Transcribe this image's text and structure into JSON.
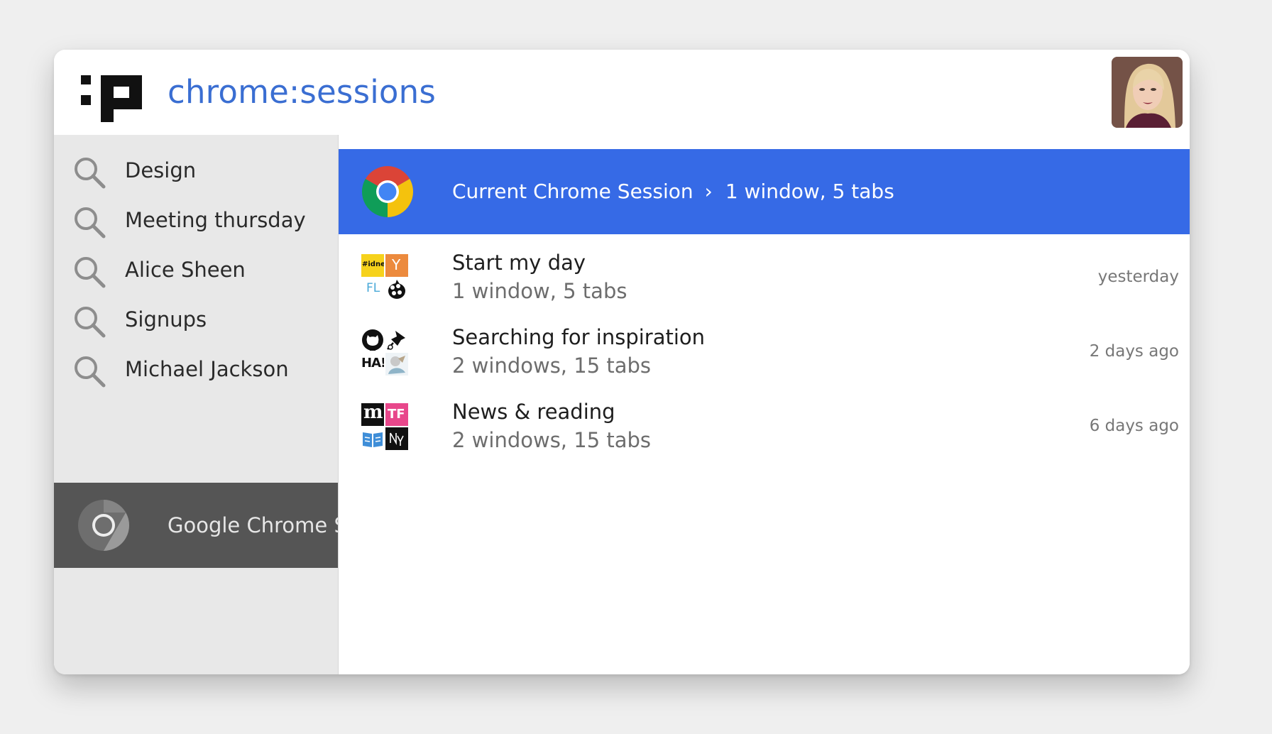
{
  "header": {
    "title": "chrome:sessions",
    "logo_icon": "pinbox-logo-icon",
    "avatar_icon": "user-avatar"
  },
  "sidebar": {
    "items": [
      {
        "label": "Design",
        "icon": "search-icon"
      },
      {
        "label": "Meeting thursday",
        "icon": "search-icon"
      },
      {
        "label": "Alice Sheen",
        "icon": "search-icon"
      },
      {
        "label": "Signups",
        "icon": "search-icon"
      },
      {
        "label": "Michael Jackson",
        "icon": "search-icon"
      }
    ],
    "active": {
      "label": "Google Chrome Sessions",
      "icon": "chrome-icon"
    }
  },
  "current_session": {
    "title": "Current Chrome Session",
    "separator": "›",
    "detail": "1 window, 5 tabs",
    "icon": "chrome-icon"
  },
  "sessions": [
    {
      "title": "Start my day",
      "detail": "1 window, 5 tabs",
      "time": "yesterday",
      "favicons": [
        "idnes-favicon",
        "ycombinator-favicon",
        "feedly-favicon",
        "hop-favicon"
      ]
    },
    {
      "title": "Searching for inspiration",
      "detail": "2 windows, 15 tabs",
      "time": "2 days ago",
      "favicons": [
        "github-favicon",
        "pin-favicon",
        "ha-favicon",
        "illustration-favicon"
      ]
    },
    {
      "title": "News & reading",
      "detail": "2 windows, 15 tabs",
      "time": "6 days ago",
      "favicons": [
        "medium-favicon",
        "techfunder-favicon",
        "book-favicon",
        "newyorker-favicon"
      ]
    }
  ],
  "favicon_text": {
    "idnes": "#idnes",
    "yc": "Y",
    "feedly": "FL",
    "ha": "HA!",
    "medium": "m",
    "tf": "TF"
  },
  "colors": {
    "accent": "#366ae6",
    "title": "#3a6ed2",
    "sidebar_bg": "#e8e8e8",
    "sidebar_active": "#555555"
  }
}
